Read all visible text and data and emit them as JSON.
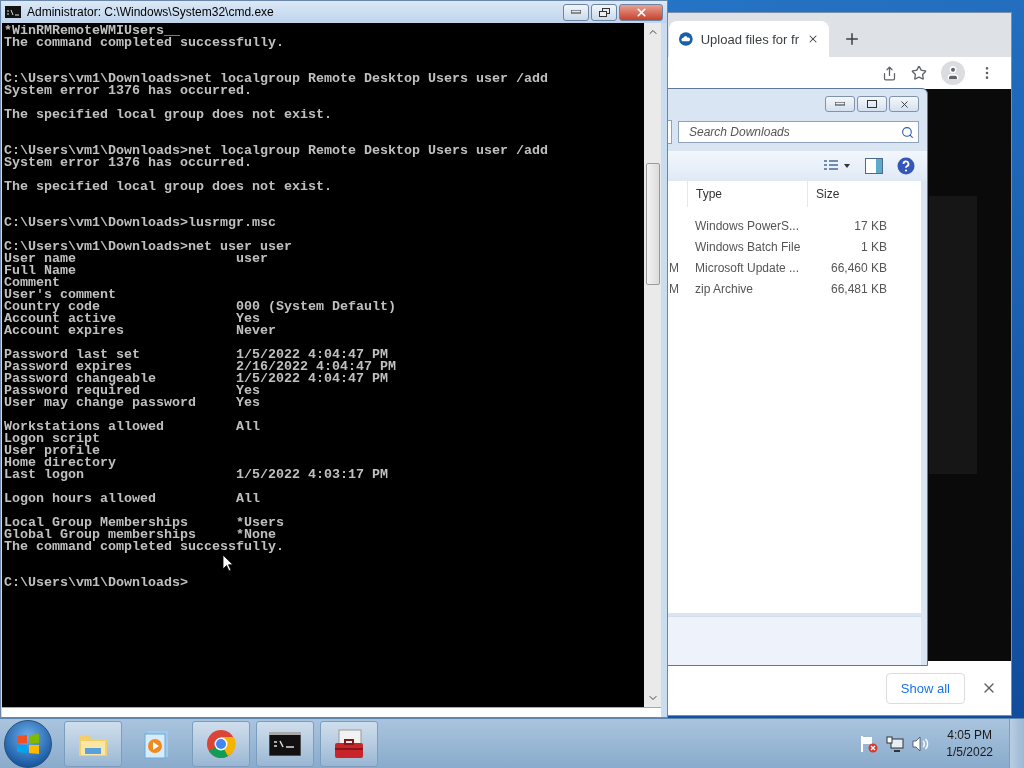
{
  "cmd_window": {
    "title": "Administrator: C:\\Windows\\System32\\cmd.exe",
    "lines": [
      {
        "kind": "text",
        "text": "*WinRMRemoteWMIUsers__"
      },
      {
        "kind": "text",
        "text": "The command completed successfully."
      },
      {
        "kind": "blank"
      },
      {
        "kind": "blank"
      },
      {
        "kind": "text",
        "text": "C:\\Users\\vm1\\Downloads>net localgroup Remote Desktop Users user /add"
      },
      {
        "kind": "text",
        "text": "System error 1376 has occurred."
      },
      {
        "kind": "blank"
      },
      {
        "kind": "text",
        "text": "The specified local group does not exist."
      },
      {
        "kind": "blank"
      },
      {
        "kind": "blank"
      },
      {
        "kind": "text",
        "text": "C:\\Users\\vm1\\Downloads>net localgroup Remote Desktop Users user /add"
      },
      {
        "kind": "text",
        "text": "System error 1376 has occurred."
      },
      {
        "kind": "blank"
      },
      {
        "kind": "text",
        "text": "The specified local group does not exist."
      },
      {
        "kind": "blank"
      },
      {
        "kind": "blank"
      },
      {
        "kind": "text",
        "text": "C:\\Users\\vm1\\Downloads>lusrmgr.msc"
      },
      {
        "kind": "blank"
      },
      {
        "kind": "text",
        "text": "C:\\Users\\vm1\\Downloads>net user user"
      },
      {
        "kind": "pair",
        "label": "User name",
        "value": "user"
      },
      {
        "kind": "pair",
        "label": "Full Name"
      },
      {
        "kind": "pair",
        "label": "Comment"
      },
      {
        "kind": "pair",
        "label": "User's comment"
      },
      {
        "kind": "pair",
        "label": "Country code",
        "value": "000 (System Default)"
      },
      {
        "kind": "pair",
        "label": "Account active",
        "value": "Yes"
      },
      {
        "kind": "pair",
        "label": "Account expires",
        "value": "Never"
      },
      {
        "kind": "blank"
      },
      {
        "kind": "pair",
        "label": "Password last set",
        "value": "1/5/2022 4:04:47 PM"
      },
      {
        "kind": "pair",
        "label": "Password expires",
        "value": "2/16/2022 4:04:47 PM"
      },
      {
        "kind": "pair",
        "label": "Password changeable",
        "value": "1/5/2022 4:04:47 PM"
      },
      {
        "kind": "pair",
        "label": "Password required",
        "value": "Yes"
      },
      {
        "kind": "pair",
        "label": "User may change password",
        "value": "Yes"
      },
      {
        "kind": "blank"
      },
      {
        "kind": "pair",
        "label": "Workstations allowed",
        "value": "All"
      },
      {
        "kind": "pair",
        "label": "Logon script"
      },
      {
        "kind": "pair",
        "label": "User profile"
      },
      {
        "kind": "pair",
        "label": "Home directory"
      },
      {
        "kind": "pair",
        "label": "Last logon",
        "value": "1/5/2022 4:03:17 PM"
      },
      {
        "kind": "blank"
      },
      {
        "kind": "pair",
        "label": "Logon hours allowed",
        "value": "All"
      },
      {
        "kind": "blank"
      },
      {
        "kind": "pair",
        "label": "Local Group Memberships",
        "value": "*Users"
      },
      {
        "kind": "pair",
        "label": "Global Group memberships",
        "value": "*None"
      },
      {
        "kind": "text",
        "text": "The command completed successfully."
      },
      {
        "kind": "blank"
      },
      {
        "kind": "blank"
      },
      {
        "kind": "text",
        "text": "C:\\Users\\vm1\\Downloads>"
      }
    ]
  },
  "browser": {
    "tab": {
      "title": "Upload files for fr",
      "selected": true
    },
    "download_bar": {
      "button": "Show all"
    }
  },
  "explorer": {
    "search": {
      "placeholder": "Search Downloads"
    },
    "columns": [
      "Type",
      "Size"
    ],
    "rows": [
      {
        "type": "Windows PowerS...",
        "size": "17 KB"
      },
      {
        "type": "Windows Batch File",
        "size": "1 KB"
      },
      {
        "column_1": "M",
        "type": "Microsoft Update ...",
        "size": "66,460 KB"
      },
      {
        "column_1": "M",
        "type": "zip Archive",
        "size": "66,481 KB"
      }
    ]
  },
  "taskbar": {
    "apps": [
      {
        "kind": "explorer",
        "running": true
      },
      {
        "kind": "media",
        "running": false
      },
      {
        "kind": "chrome",
        "running": true
      },
      {
        "kind": "console",
        "running": true
      },
      {
        "kind": "toolbox",
        "running": true
      }
    ],
    "clock": {
      "time": "4:05 PM",
      "date": "1/5/2022"
    }
  }
}
